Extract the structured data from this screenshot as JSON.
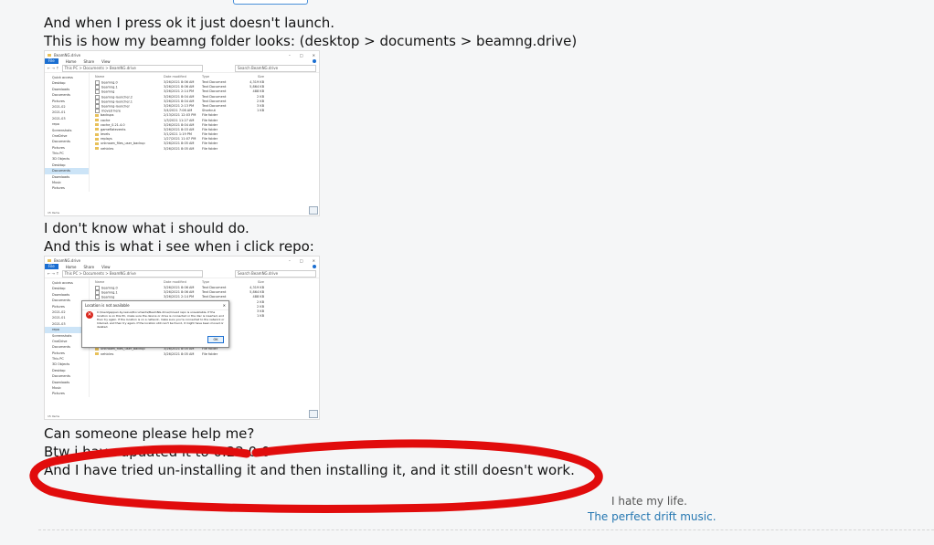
{
  "post": {
    "line1": "And when I press ok it just doesn't launch.",
    "line2": "This is how my beamng folder looks: (desktop > documents > beamng.drive)",
    "line3": "I don't know what i should do.",
    "line4": "And this is what i see when i click repo:",
    "line5": "Can someone please help me?",
    "line6": "Btw i have updated it to 0.22.0.0",
    "line7": "And I have tried un-installing it and then installing it, and it still doesn't work."
  },
  "explorer": {
    "title": "BeamNG.drive",
    "ribbon": [
      "File",
      "Home",
      "Share",
      "View"
    ],
    "path": "This PC  >  Documents  >  BeamNG.drive",
    "search_placeholder": "Search BeamNG.drive",
    "columns": [
      "Name",
      "Date modified",
      "Type",
      "Size"
    ],
    "nav": [
      "Quick access",
      "Desktop",
      "Downloads",
      "Documents",
      "Pictures",
      "2021-02",
      "2021-01",
      "2021-03",
      "repo",
      "Screenshots",
      "OneDrive",
      "Documents",
      "Pictures",
      "This PC",
      "3D Objects",
      "Desktop",
      "Documents",
      "Downloads",
      "Music",
      "Pictures"
    ],
    "files": [
      {
        "name": "beamng.0",
        "date": "3/26/2021 8:06 AM",
        "type": "Text Document",
        "size": "4,319 KB",
        "icon": "doc"
      },
      {
        "name": "beamng.1",
        "date": "3/26/2021 8:06 AM",
        "type": "Text Document",
        "size": "5,864 KB",
        "icon": "doc"
      },
      {
        "name": "beamng",
        "date": "3/26/2021 2:14 PM",
        "type": "Text Document",
        "size": "488 KB",
        "icon": "doc"
      },
      {
        "name": "beamng-launcher.2",
        "date": "3/26/2021 8:04 AM",
        "type": "Text Document",
        "size": "2 KB",
        "icon": "doc"
      },
      {
        "name": "beamng-launcher.1",
        "date": "3/26/2021 8:04 AM",
        "type": "Text Document",
        "size": "2 KB",
        "icon": "doc"
      },
      {
        "name": "beamng-launcher",
        "date": "3/26/2021 2:13 PM",
        "type": "Text Document",
        "size": "3 KB",
        "icon": "doc"
      },
      {
        "name": "moved here",
        "date": "3/4/2021 7:06 AM",
        "type": "Shortcut",
        "size": "1 KB",
        "icon": "doc"
      },
      {
        "name": "backups",
        "date": "2/13/2021 12:03 PM",
        "type": "File folder",
        "size": "",
        "icon": "folder"
      },
      {
        "name": "cache",
        "date": "1/3/2021 11:27 AM",
        "type": "File folder",
        "size": "",
        "icon": "folder"
      },
      {
        "name": "cache_0.21.4.0",
        "date": "3/26/2021 8:04 AM",
        "type": "File folder",
        "size": "",
        "icon": "folder"
      },
      {
        "name": "gameflatevents",
        "date": "3/26/2021 8:03 AM",
        "type": "File folder",
        "size": "",
        "icon": "folder"
      },
      {
        "name": "levels",
        "date": "3/1/2021 1:19 PM",
        "type": "File folder",
        "size": "",
        "icon": "folder"
      },
      {
        "name": "replays",
        "date": "1/27/2021 11:07 PM",
        "type": "File folder",
        "size": "",
        "icon": "folder"
      },
      {
        "name": "unknown_files_user_backup",
        "date": "3/26/2021 8:05 AM",
        "type": "File folder",
        "size": "",
        "icon": "folder"
      },
      {
        "name": "vehicles",
        "date": "3/26/2021 8:05 AM",
        "type": "File folder",
        "size": "",
        "icon": "folder"
      }
    ],
    "status": "15 items",
    "dialog": {
      "title": "Location is not available",
      "message": "C:\\Users\\Jeppen.by.nexus\\Documents\\BeamNG.drive\\moved repo is unavailable. If the location is on this PC, make sure the device or drive is connected or the disc is inserted, and then try again. If the location is on a network, make sure you're connected to the network or Internet, and then try again. If the location still can't be found, it might have been moved or deleted.",
      "ok": "OK"
    }
  },
  "signature": {
    "line1": "I hate my life.",
    "line2": "The perfect drift music."
  },
  "colors": {
    "scribble": "#e10c0c",
    "link": "#2577b1"
  }
}
